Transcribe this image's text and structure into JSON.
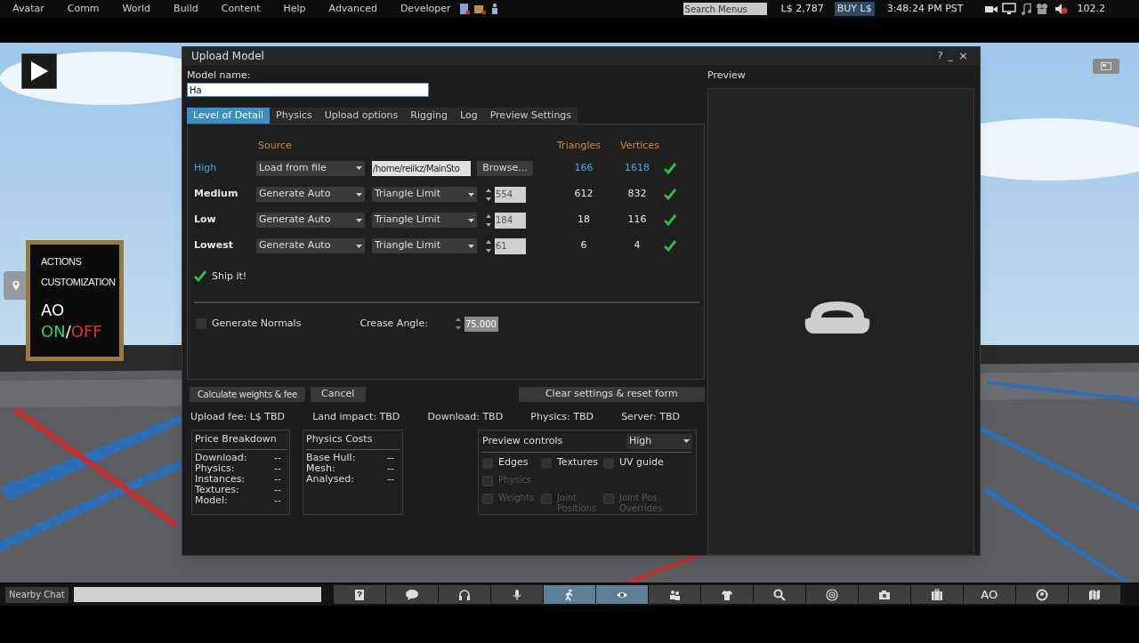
{
  "menu_bar": {
    "items": [
      "Avatar",
      "Comm",
      "World",
      "Build",
      "Content",
      "Help",
      "Advanced",
      "Developer"
    ],
    "search": {
      "placeholder": "Search Menus"
    },
    "balance": "L$ 2,787",
    "buy": "BUY L$",
    "time": "3:48:24 PM PST",
    "fps": "102.2"
  },
  "ao_hud": {
    "lines": [
      "ACTIONS",
      "CUSTOMIZATION"
    ],
    "title": "AO",
    "on": "ON",
    "separator": "/",
    "off": "OFF"
  },
  "dialog": {
    "title": "Upload Model",
    "help": "?",
    "minimize": "_",
    "close": "×",
    "model_name": {
      "label": "Model name:",
      "value": "Ha"
    },
    "tabs": [
      {
        "label": "Level of Detail",
        "selected": true
      },
      {
        "label": "Physics",
        "selected": false
      },
      {
        "label": "Upload options",
        "selected": false
      },
      {
        "label": "Rigging",
        "selected": false
      },
      {
        "label": "Log",
        "selected": false
      },
      {
        "label": "Preview Settings",
        "selected": false
      }
    ],
    "lod": {
      "headers": {
        "source": "Source",
        "triangles": "Triangles",
        "vertices": "Vertices"
      },
      "rows": [
        {
          "label": "High",
          "selected": true,
          "source": "Load from file",
          "kind": "file",
          "file": "/home/reiikz/MainSto",
          "button": "Browse...",
          "triangles": "166",
          "vertices": "1618",
          "ok": true
        },
        {
          "label": "Medium",
          "selected": false,
          "source": "Generate Auto",
          "kind": "limit",
          "mode": "Triangle Limit",
          "limit": "554",
          "triangles": "612",
          "vertices": "832",
          "ok": true
        },
        {
          "label": "Low",
          "selected": false,
          "source": "Generate Auto",
          "kind": "limit",
          "mode": "Triangle Limit",
          "limit": "184",
          "triangles": "18",
          "vertices": "116",
          "ok": true
        },
        {
          "label": "Lowest",
          "selected": false,
          "source": "Generate Auto",
          "kind": "limit",
          "mode": "Triangle Limit",
          "limit": "61",
          "triangles": "6",
          "vertices": "4",
          "ok": true
        }
      ],
      "status": {
        "label": "Ship it!",
        "ok": true
      }
    },
    "generate_normals": {
      "label": "Generate Normals",
      "checked": false
    },
    "crease_angle": {
      "label": "Crease Angle:",
      "value": "75.000"
    },
    "buttons": {
      "calculate": "Calculate weights & fee",
      "cancel": "Cancel",
      "clear": "Clear settings & reset form"
    },
    "summary": [
      "Upload fee: L$ TBD",
      "Land impact: TBD",
      "Download: TBD",
      "Physics: TBD",
      "Server: TBD"
    ],
    "price_breakdown": {
      "title": "Price Breakdown",
      "rows": [
        {
          "label": "Download:",
          "value": "--"
        },
        {
          "label": "Physics:",
          "value": "--"
        },
        {
          "label": "Instances:",
          "value": "--"
        },
        {
          "label": "Textures:",
          "value": "--"
        },
        {
          "label": "Model:",
          "value": "--"
        }
      ]
    },
    "physics_costs": {
      "title": "Physics Costs",
      "rows": [
        {
          "label": "Base Hull:",
          "value": "--"
        },
        {
          "label": "Mesh:",
          "value": "--"
        },
        {
          "label": "Analysed:",
          "value": "--"
        }
      ]
    },
    "preview_controls": {
      "title": "Preview controls",
      "lod": "High",
      "rows": [
        [
          {
            "label": "Edges",
            "checked": false,
            "disabled": false
          },
          {
            "label": "Textures",
            "checked": false,
            "disabled": false
          },
          {
            "label": "UV guide",
            "checked": false,
            "disabled": false
          }
        ],
        [
          {
            "label": "Physics",
            "checked": false,
            "disabled": true
          }
        ],
        [
          {
            "label": "Weights",
            "checked": false,
            "disabled": true
          },
          {
            "label": "Joint Positions",
            "checked": false,
            "disabled": true
          },
          {
            "label": "Joint Pos Overrides",
            "checked": false,
            "disabled": true
          }
        ]
      ]
    },
    "preview": {
      "title": "Preview"
    }
  },
  "chat": {
    "button": "Nearby Chat"
  },
  "toolbar": [
    {
      "kind": "help",
      "selected": false
    },
    {
      "kind": "chat",
      "selected": false
    },
    {
      "kind": "voice",
      "selected": false
    },
    {
      "kind": "mic",
      "selected": false
    },
    {
      "kind": "walk",
      "selected": true
    },
    {
      "kind": "view",
      "selected": true
    },
    {
      "kind": "people",
      "selected": false
    },
    {
      "kind": "shirt",
      "selected": false
    },
    {
      "kind": "search",
      "selected": false
    },
    {
      "kind": "radar",
      "selected": false
    },
    {
      "kind": "camera",
      "selected": false
    },
    {
      "kind": "inventory",
      "selected": false
    },
    {
      "kind": "ao",
      "label": "AO",
      "selected": false
    },
    {
      "kind": "avatar",
      "selected": false
    },
    {
      "kind": "map",
      "selected": false
    }
  ]
}
